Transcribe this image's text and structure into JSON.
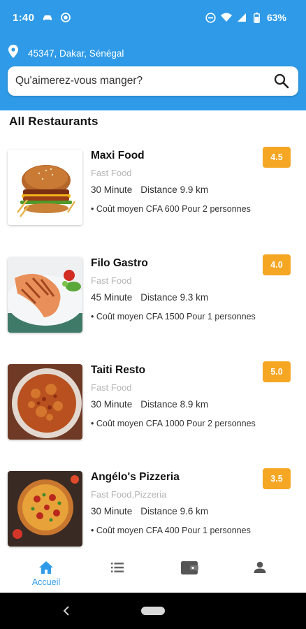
{
  "status_bar": {
    "time": "1:40",
    "battery": "63%"
  },
  "location": {
    "text": "45347, Dakar, Sénégal"
  },
  "search": {
    "placeholder": "Qu'aimerez-vous manger?"
  },
  "section": {
    "title": "All Restaurants"
  },
  "restaurants": [
    {
      "name": "Maxi Food",
      "category": "Fast Food",
      "time": "30 Minute",
      "distance": "Distance 9.9 km",
      "cost": "• Coût moyen CFA 600 Pour 2 personnes",
      "rating": "4.5",
      "image": "burger"
    },
    {
      "name": "Filo Gastro",
      "category": "Fast Food",
      "time": "45 Minute",
      "distance": "Distance 9.3 km",
      "cost": "• Coût moyen CFA 1500 Pour 1 personnes",
      "rating": "4.0",
      "image": "salmon-steak"
    },
    {
      "name": "Taiti Resto",
      "category": "Fast Food",
      "time": "30 Minute",
      "distance": "Distance 8.9 km",
      "cost": "• Coût moyen CFA 1000 Pour 2 personnes",
      "rating": "5.0",
      "image": "rice-dish"
    },
    {
      "name": "Angélo's Pizzeria",
      "category": "Fast Food,Pizzeria",
      "time": "30 Minute",
      "distance": "Distance 9.6 km",
      "cost": "• Coût moyen CFA 400 Pour 1 personnes",
      "rating": "3.5",
      "image": "pizza"
    }
  ],
  "bottom_nav": {
    "items": [
      {
        "label": "Accueil",
        "icon": "home-icon",
        "active": true
      },
      {
        "label": "",
        "icon": "list-icon",
        "active": false
      },
      {
        "label": "",
        "icon": "wallet-icon",
        "active": false
      },
      {
        "label": "",
        "icon": "person-icon",
        "active": false
      }
    ]
  },
  "colors": {
    "primary": "#2f9be8",
    "rating_badge": "#f5a623",
    "category_text": "#b5b5b5"
  }
}
